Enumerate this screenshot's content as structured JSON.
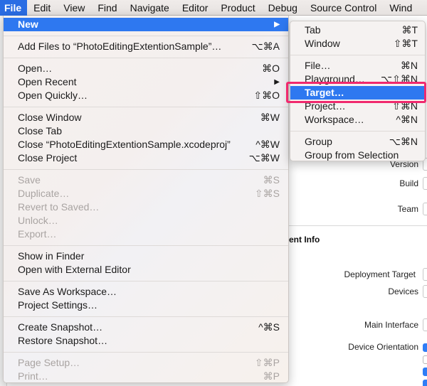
{
  "menubar": {
    "items": [
      {
        "label": "File",
        "active": true
      },
      {
        "label": "Edit"
      },
      {
        "label": "View"
      },
      {
        "label": "Find"
      },
      {
        "label": "Navigate"
      },
      {
        "label": "Editor"
      },
      {
        "label": "Product"
      },
      {
        "label": "Debug"
      },
      {
        "label": "Source Control"
      },
      {
        "label": "Wind"
      }
    ]
  },
  "file_menu": {
    "items": [
      {
        "label": "New",
        "submenu": true,
        "highlighted": true
      },
      {
        "label": "Add Files to “PhotoEditingExtentionSample”…",
        "shortcut": "⌥⌘A"
      },
      {
        "label": "Open…",
        "shortcut": "⌘O"
      },
      {
        "label": "Open Recent",
        "submenu": true
      },
      {
        "label": "Open Quickly…",
        "shortcut": "⇧⌘O"
      },
      {
        "label": "Close Window",
        "shortcut": "⌘W"
      },
      {
        "label": "Close Tab"
      },
      {
        "label": "Close “PhotoEditingExtentionSample.xcodeproj”",
        "shortcut": "^⌘W"
      },
      {
        "label": "Close Project",
        "shortcut": "⌥⌘W"
      },
      {
        "label": "Save",
        "shortcut": "⌘S",
        "disabled": true
      },
      {
        "label": "Duplicate…",
        "shortcut": "⇧⌘S",
        "disabled": true
      },
      {
        "label": "Revert to Saved…",
        "disabled": true
      },
      {
        "label": "Unlock…",
        "disabled": true
      },
      {
        "label": "Export…",
        "disabled": true
      },
      {
        "label": "Show in Finder"
      },
      {
        "label": "Open with External Editor"
      },
      {
        "label": "Save As Workspace…"
      },
      {
        "label": "Project Settings…"
      },
      {
        "label": "Create Snapshot…",
        "shortcut": "^⌘S"
      },
      {
        "label": "Restore Snapshot…"
      },
      {
        "label": "Page Setup…",
        "shortcut": "⇧⌘P",
        "disabled": true
      },
      {
        "label": "Print…",
        "shortcut": "⌘P",
        "disabled": true
      }
    ],
    "submenu_arrow": "▶"
  },
  "new_submenu": {
    "items": [
      {
        "label": "Tab",
        "shortcut": "⌘T"
      },
      {
        "label": "Window",
        "shortcut": "⇧⌘T"
      },
      {
        "label": "File…",
        "shortcut": "⌘N"
      },
      {
        "label": "Playground…",
        "shortcut": "⌥⇧⌘N"
      },
      {
        "label": "Target…",
        "highlighted": true
      },
      {
        "label": "Project…",
        "shortcut": "⇧⌘N"
      },
      {
        "label": "Workspace…",
        "shortcut": "^⌘N"
      },
      {
        "label": "Group",
        "shortcut": "⌥⌘N"
      },
      {
        "label": "Group from Selection"
      }
    ]
  },
  "background_editor": {
    "labels": {
      "version": "Version",
      "build": "Build",
      "team": "Team",
      "section_deployment": "ent Info",
      "deployment_target": "Deployment Target",
      "devices": "Devices",
      "main_interface": "Main Interface",
      "device_orientation": "Device Orientation"
    },
    "orientation_checks": [
      true,
      false,
      true,
      true
    ]
  },
  "colors": {
    "menu_highlight": "#2e78f0",
    "annotation": "#f0296e"
  }
}
